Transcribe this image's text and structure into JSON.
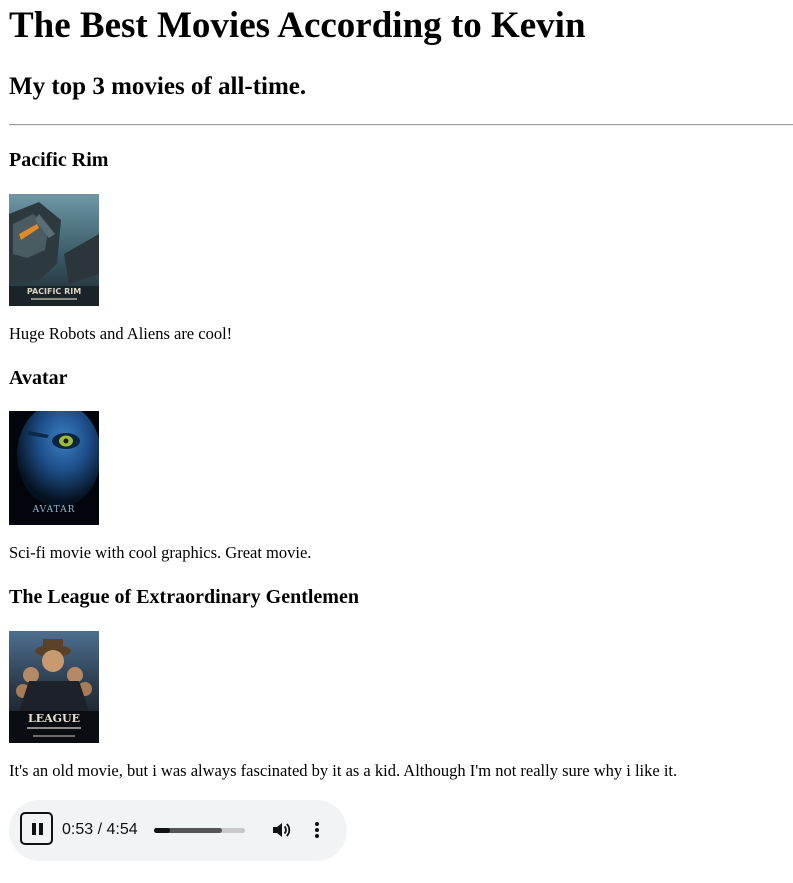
{
  "page": {
    "title": "The Best Movies According to Kevin",
    "subtitle": "My top 3 movies of all-time."
  },
  "movies": [
    {
      "title": "Pacific Rim",
      "description": "Huge Robots and Aliens are cool!",
      "poster_text": "PACIFIC RIM"
    },
    {
      "title": "Avatar",
      "description": "Sci-fi movie with cool graphics. Great movie.",
      "poster_text": "AVATAR"
    },
    {
      "title": "The League of Extraordinary Gentlemen",
      "description": "It's an old movie, but i was always fascinated by it as a kid. Although I'm not really sure why i like it.",
      "poster_text": "LEAGUE"
    }
  ],
  "audio": {
    "state": "playing",
    "time_display": "0:53 / 4:54",
    "progress_fraction": 0.18,
    "buffered_fraction": 0.75,
    "icons": {
      "play_pause": "pause-icon",
      "volume": "volume-icon",
      "menu": "more-options-icon"
    }
  }
}
